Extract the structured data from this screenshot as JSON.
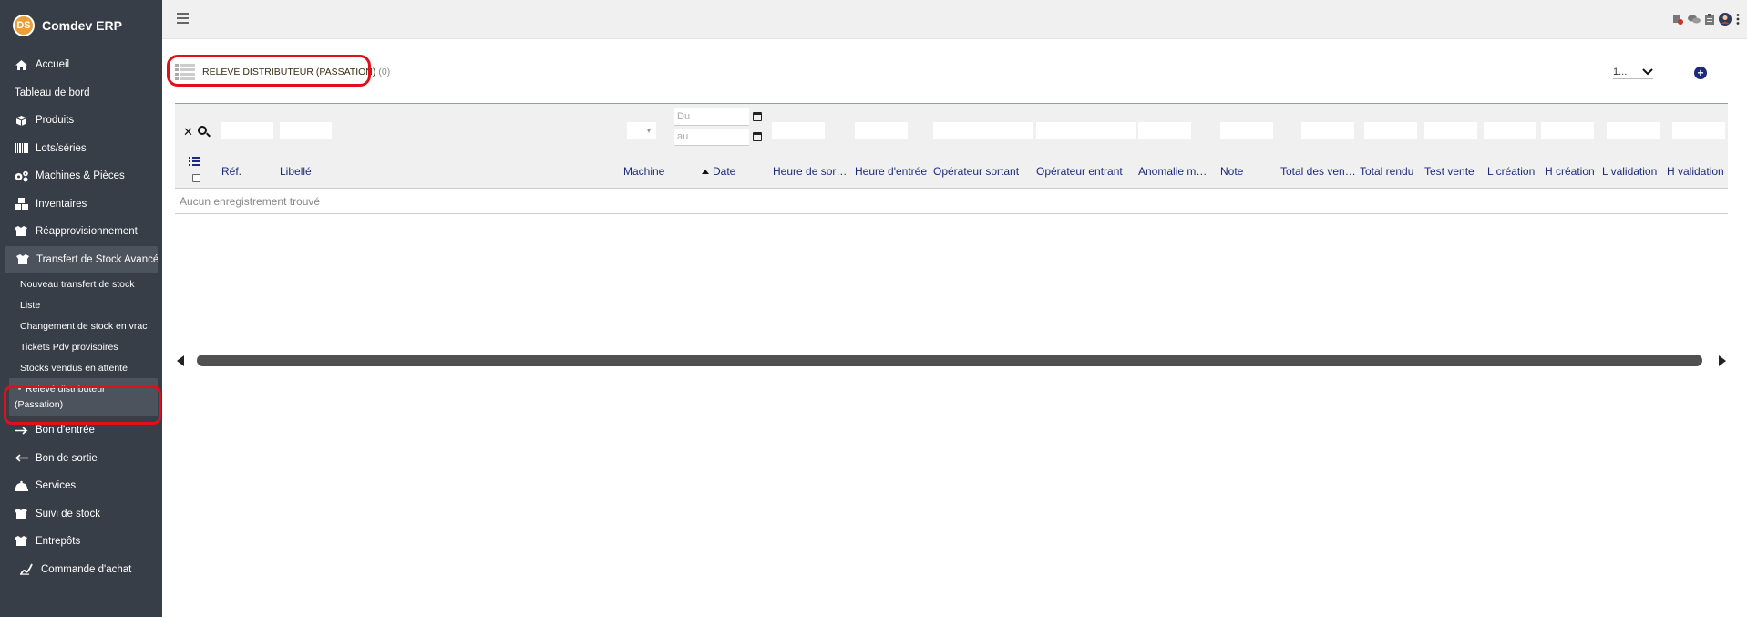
{
  "app": {
    "name": "Comdev ERP",
    "logo_letters": "DS"
  },
  "sidebar": {
    "items": [
      {
        "label": "Accueil",
        "icon": "home-icon"
      },
      {
        "label": "Tableau de bord",
        "icon": ""
      },
      {
        "label": "Produits",
        "icon": "cube-icon"
      },
      {
        "label": "Lots/séries",
        "icon": "barcode-icon"
      },
      {
        "label": "Machines & Pièces",
        "icon": "cogs-icon"
      },
      {
        "label": "Inventaires",
        "icon": "boxes-icon"
      },
      {
        "label": "Réapprovisionnement",
        "icon": "box-open-icon"
      },
      {
        "label": "Transfert de Stock Avancé",
        "icon": "box-open-icon"
      }
    ],
    "subitems": [
      {
        "label": "Nouveau transfert de stock"
      },
      {
        "label": "Liste"
      },
      {
        "label": "Changement de stock en vrac"
      },
      {
        "label": "Tickets Pdv provisoires"
      },
      {
        "label": "Stocks vendus en attente"
      }
    ],
    "active_subitem": {
      "line1": "Relevé distributeur",
      "line2": "(Passation)"
    },
    "items_after": [
      {
        "label": "Bon d'entrée",
        "icon": "arrow-right-icon"
      },
      {
        "label": "Bon de sortie",
        "icon": "arrow-left-icon"
      },
      {
        "label": "Services",
        "icon": "bell-icon"
      },
      {
        "label": "Suivi de stock",
        "icon": "box-open-icon"
      },
      {
        "label": "Entrepôts",
        "icon": "box-open-icon"
      },
      {
        "label": "Commande d'achat",
        "icon": "signature-icon"
      }
    ]
  },
  "page": {
    "title": "Relevé distributeur (Passation)",
    "count": "(0)",
    "per_page": "1..."
  },
  "table": {
    "date_from_placeholder": "Du",
    "date_to_placeholder": "au",
    "columns": {
      "ref": "Réf.",
      "libelle": "Libellé",
      "machine": "Machine",
      "date": "Date",
      "heure_sortie": "Heure de sortie",
      "heure_entree": "Heure d'entrée",
      "operateur_sortant": "Opérateur sortant",
      "operateur_entrant": "Opérateur entrant",
      "anomalie": "Anomalie machine",
      "note": "Note",
      "total_ventes": "Total des ventes",
      "total_rendu": "Total rendu",
      "test_vente": "Test vente",
      "l_creation": "L création",
      "h_creation": "H création",
      "l_validation": "L validation",
      "h_validation": "H validation"
    },
    "empty_message": "Aucun enregistrement trouvé"
  },
  "colors": {
    "sidebar_bg": "#373e47",
    "accent": "#1b2a7a",
    "highlight": "#e0101a"
  }
}
